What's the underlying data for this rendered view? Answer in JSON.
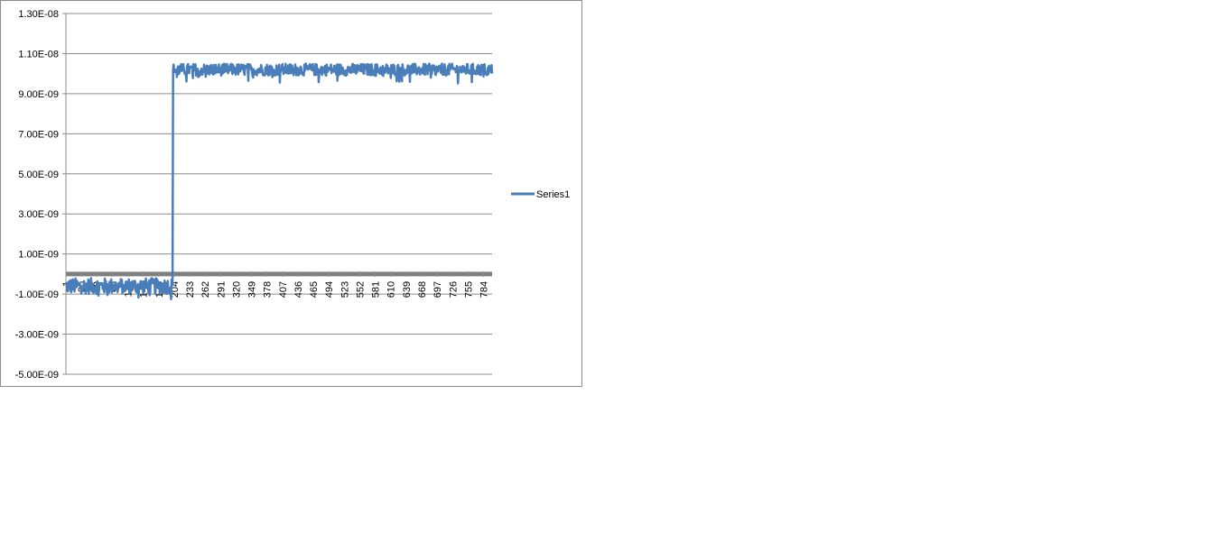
{
  "chart_data": {
    "type": "line",
    "title": "",
    "xlabel": "",
    "ylabel": "",
    "ylim": [
      -5e-09,
      1.3e-08
    ],
    "ytick_step": 1e-09,
    "ytick_labels": [
      "1.30E-08",
      "1.10E-08",
      "9.00E-09",
      "7.00E-09",
      "5.00E-09",
      "3.00E-09",
      "1.00E-09",
      "-1.00E-09",
      "-3.00E-09",
      "-5.00E-09"
    ],
    "ytick_values": [
      1.3e-08,
      1.1e-08,
      9e-09,
      7e-09,
      5e-09,
      3e-09,
      1e-09,
      -1e-09,
      -3e-09,
      -5e-09
    ],
    "x_range": [
      1,
      800
    ],
    "xtick_labels": [
      "1",
      "30",
      "59",
      "88",
      "117",
      "146",
      "175",
      "204",
      "233",
      "262",
      "291",
      "320",
      "349",
      "378",
      "407",
      "436",
      "465",
      "494",
      "523",
      "552",
      "581",
      "610",
      "639",
      "668",
      "697",
      "726",
      "755",
      "784"
    ],
    "grid": true,
    "legend_position": "right",
    "series": [
      {
        "name": "Series1",
        "color": "#4a7ebb",
        "step_at_x": 202,
        "baseline_level": -6e-10,
        "baseline_noise": 4e-10,
        "high_level": 1.02e-08,
        "high_noise": 3e-10
      }
    ],
    "reference_series": {
      "color": "#7f7f7f",
      "value": 0
    }
  }
}
